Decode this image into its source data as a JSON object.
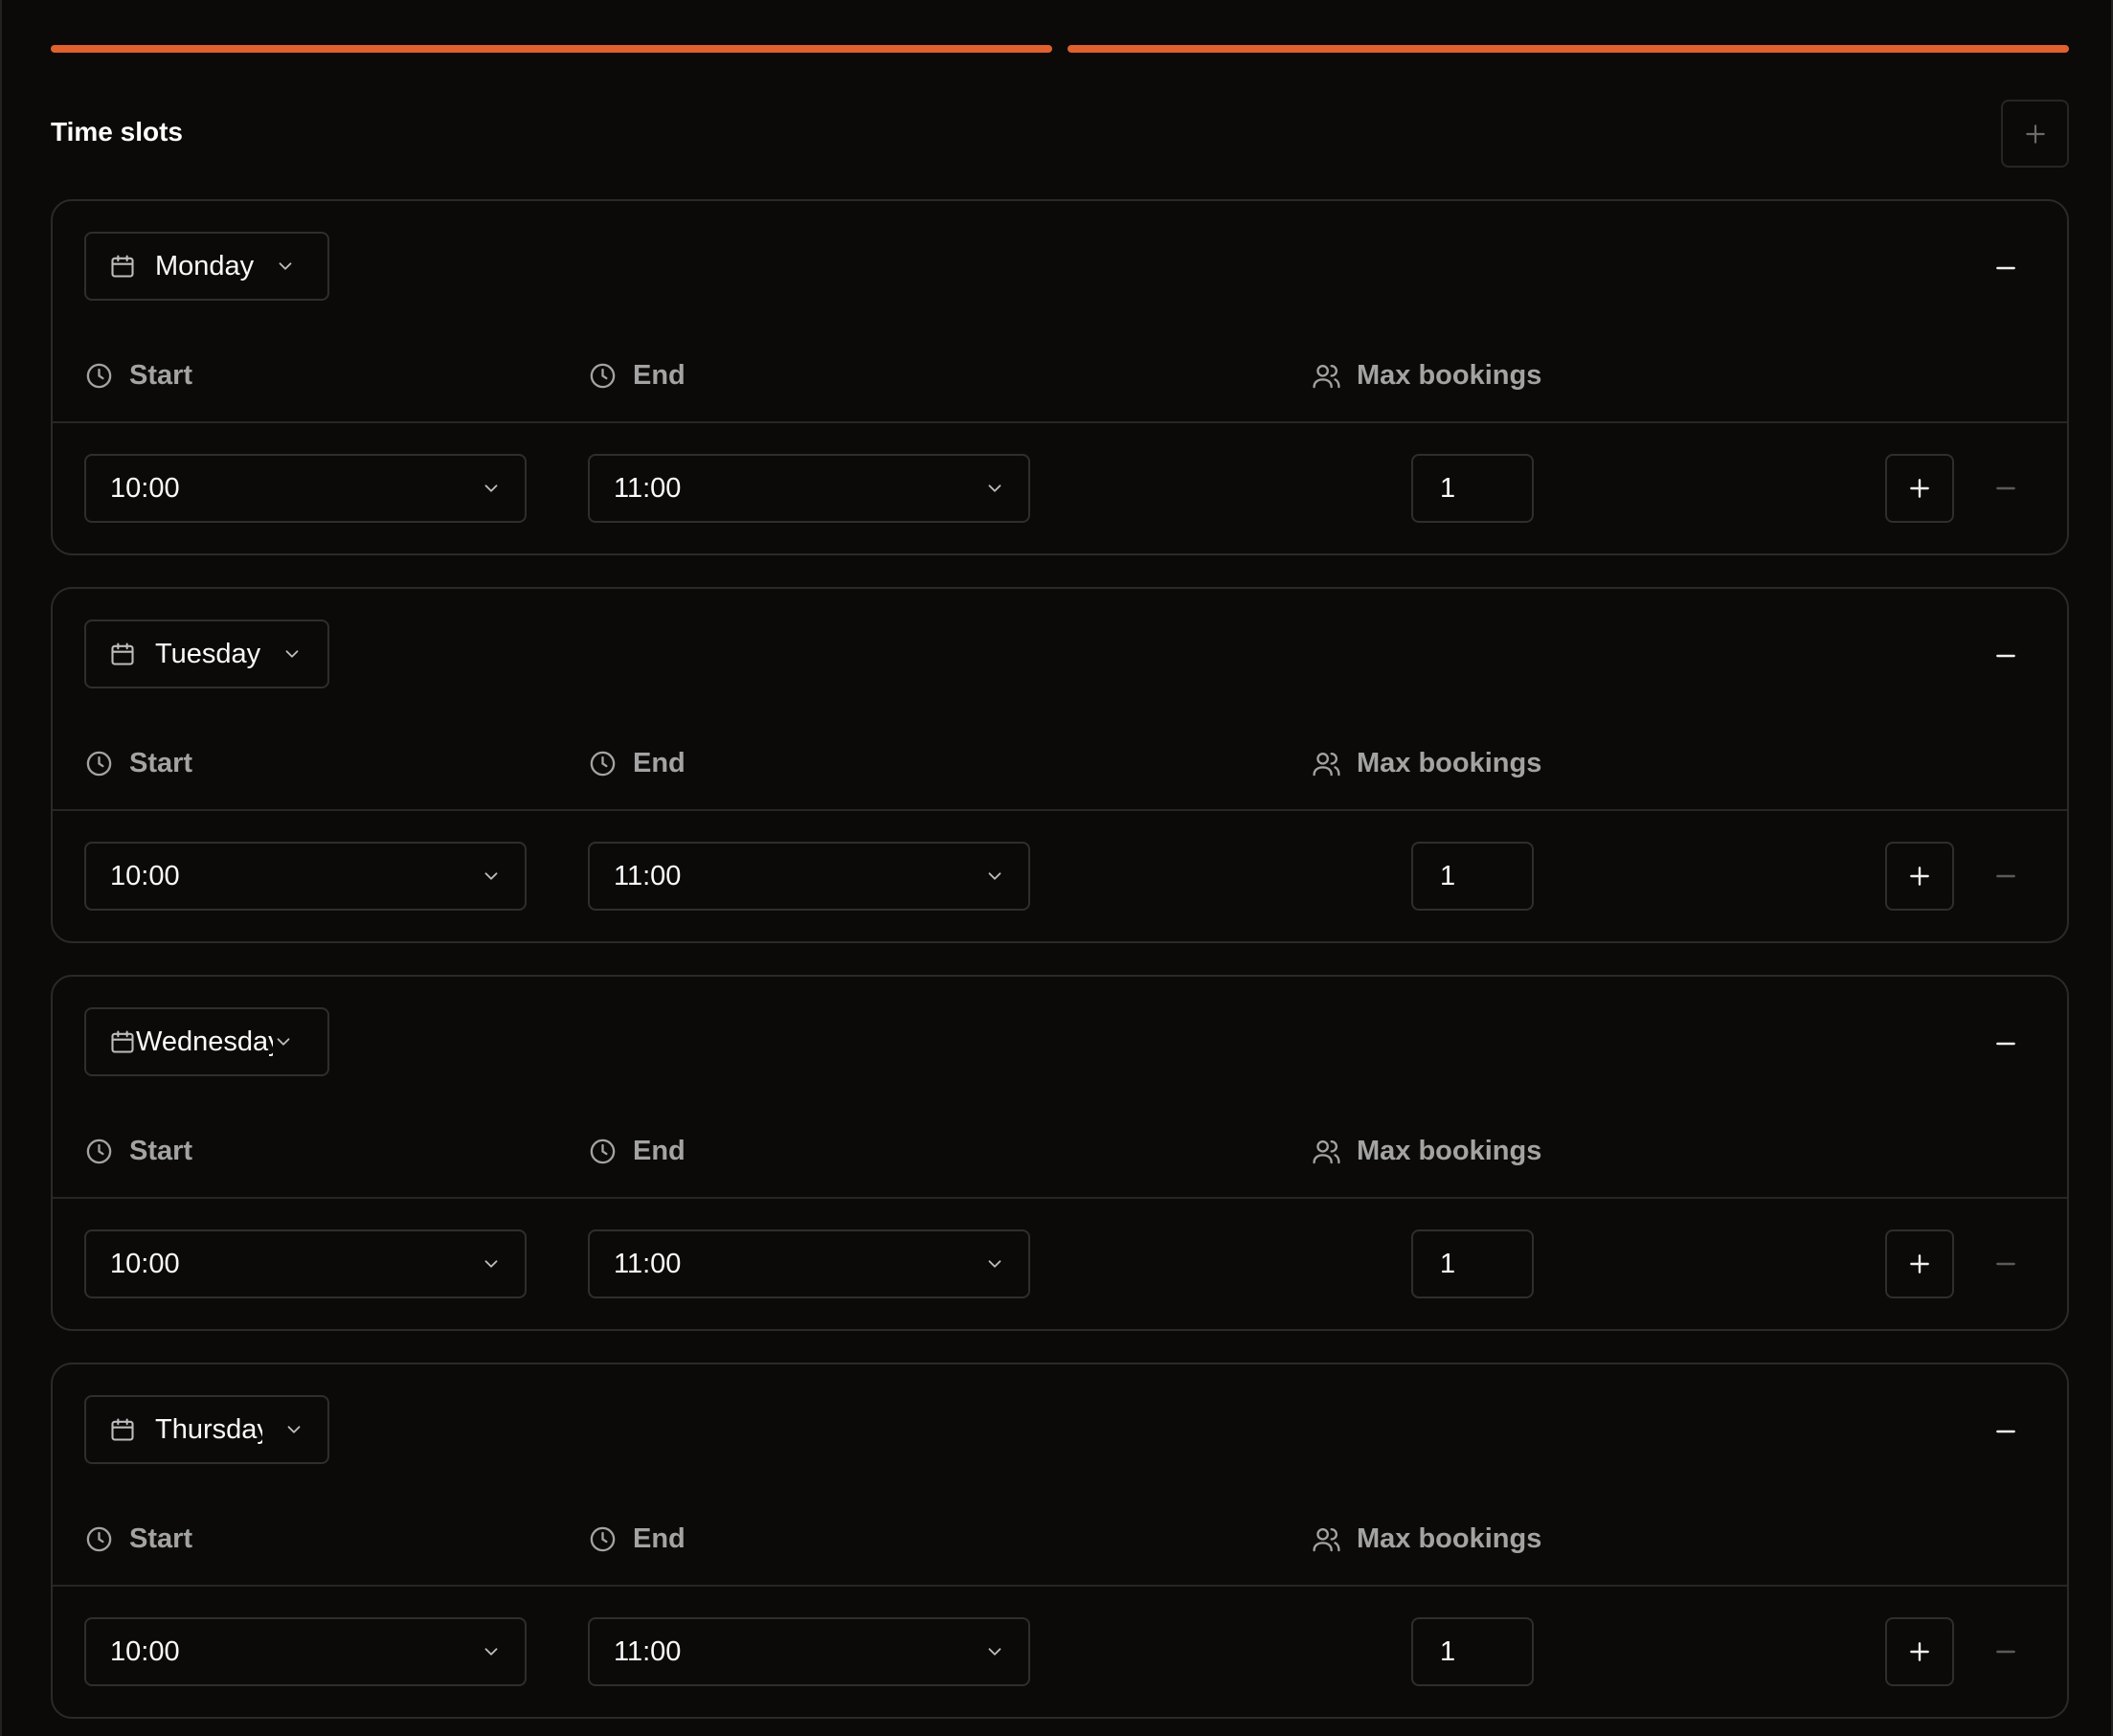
{
  "section": {
    "title": "Time slots",
    "accent_color": "#e0612e"
  },
  "columns": {
    "start": "Start",
    "end": "End",
    "max_bookings": "Max bookings"
  },
  "days": [
    {
      "day": "Monday",
      "start": "10:00",
      "end": "11:00",
      "max_bookings": "1"
    },
    {
      "day": "Tuesday",
      "start": "10:00",
      "end": "11:00",
      "max_bookings": "1"
    },
    {
      "day": "Wednesday",
      "start": "10:00",
      "end": "11:00",
      "max_bookings": "1"
    },
    {
      "day": "Thursday",
      "start": "10:00",
      "end": "11:00",
      "max_bookings": "1"
    }
  ]
}
